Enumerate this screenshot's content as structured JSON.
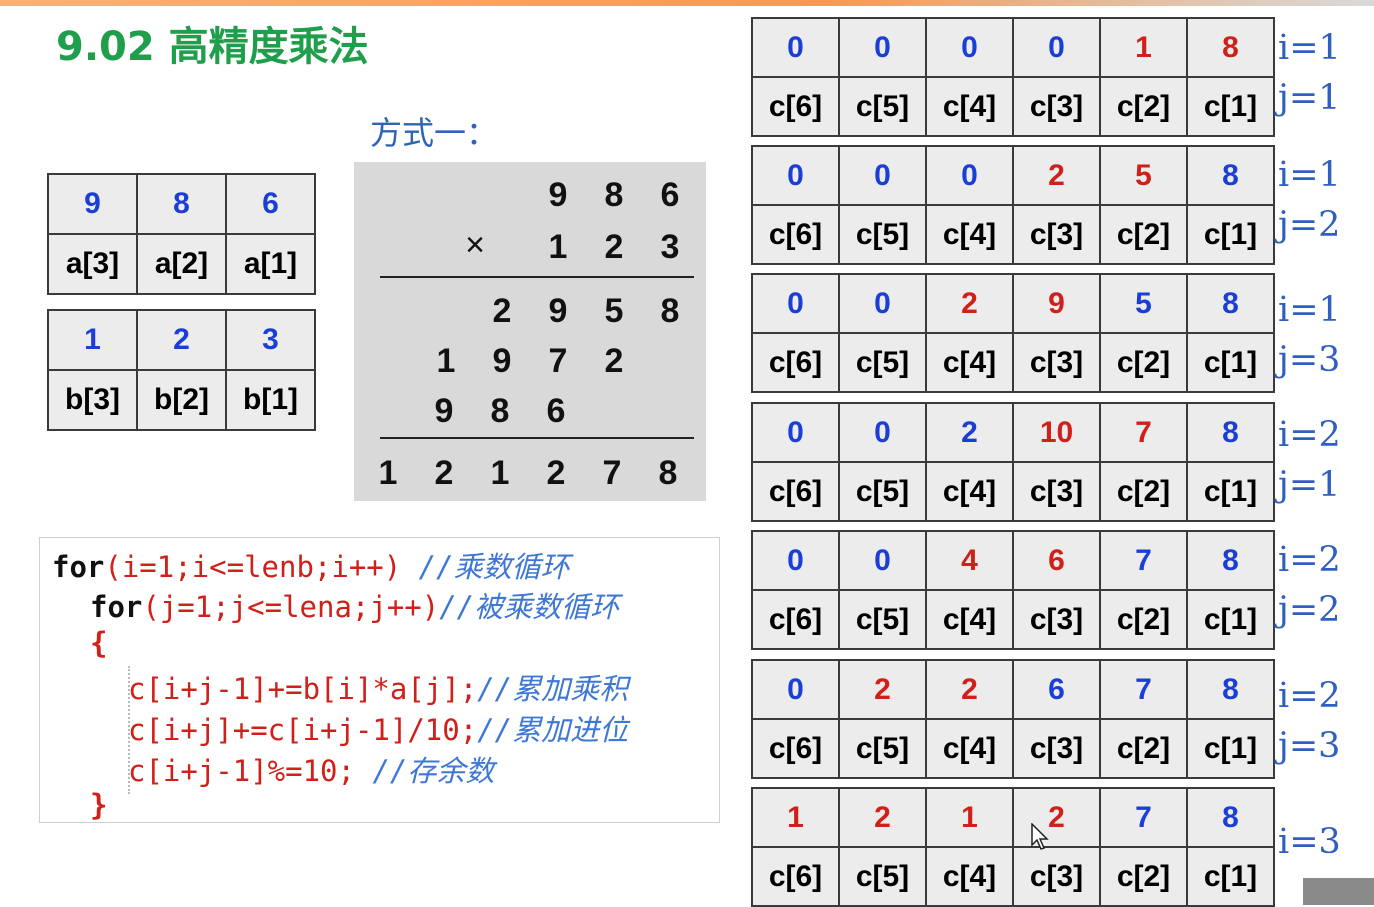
{
  "title": "9.02 高精度乘法",
  "method_label": "方式一：",
  "array_a": {
    "values": [
      "9",
      "8",
      "6"
    ],
    "labels": [
      "a[3]",
      "a[2]",
      "a[1]"
    ]
  },
  "array_b": {
    "values": [
      "1",
      "2",
      "3"
    ],
    "labels": [
      "b[3]",
      "b[2]",
      "b[1]"
    ]
  },
  "calculation": {
    "multiplicand": [
      "9",
      "8",
      "6"
    ],
    "times_sign": "×",
    "multiplier": [
      "1",
      "2",
      "3"
    ],
    "partial1": [
      "2",
      "9",
      "5",
      "8"
    ],
    "partial2": [
      "1",
      "9",
      "7",
      "2"
    ],
    "partial3": [
      "9",
      "8",
      "6"
    ],
    "result": [
      "1",
      "2",
      "1",
      "2",
      "7",
      "8"
    ]
  },
  "code": {
    "line1_a": "for",
    "line1_b": "(i=1;i<=lenb;i++)",
    "line1_c": " //乘数循环",
    "line2_a": "for",
    "line2_b": "(j=1;j<=lena;j++)",
    "line2_c": "//被乘数循环",
    "line3": "{",
    "line4_a": "c[i+j-1]+=b[i]*a[j];",
    "line4_c": "//累加乘积",
    "line5_a": "c[i+j]+=c[i+j-1]/10;",
    "line5_c": "//累加进位",
    "line6_a": "c[i+j-1]%=10;",
    "line6_c": " //存余数",
    "line7": "}"
  },
  "c_labels": [
    "c[6]",
    "c[5]",
    "c[4]",
    "c[3]",
    "c[2]",
    "c[1]"
  ],
  "steps": [
    {
      "i": "i=1",
      "j": "j=1",
      "values": [
        "0",
        "0",
        "0",
        "0",
        "1",
        "8"
      ],
      "colors": [
        "blue",
        "blue",
        "blue",
        "blue",
        "red",
        "red"
      ]
    },
    {
      "i": "i=1",
      "j": "j=2",
      "values": [
        "0",
        "0",
        "0",
        "2",
        "5",
        "8"
      ],
      "colors": [
        "blue",
        "blue",
        "blue",
        "red",
        "red",
        "blue"
      ]
    },
    {
      "i": "i=1",
      "j": "j=3",
      "values": [
        "0",
        "0",
        "2",
        "9",
        "5",
        "8"
      ],
      "colors": [
        "blue",
        "blue",
        "red",
        "red",
        "blue",
        "blue"
      ]
    },
    {
      "i": "i=2",
      "j": "j=1",
      "values": [
        "0",
        "0",
        "2",
        "10",
        "7",
        "8"
      ],
      "colors": [
        "blue",
        "blue",
        "blue",
        "red",
        "red",
        "blue"
      ]
    },
    {
      "i": "i=2",
      "j": "j=2",
      "values": [
        "0",
        "0",
        "4",
        "6",
        "7",
        "8"
      ],
      "colors": [
        "blue",
        "blue",
        "red",
        "red",
        "blue",
        "blue"
      ]
    },
    {
      "i": "i=2",
      "j": "j=3",
      "values": [
        "0",
        "2",
        "2",
        "6",
        "7",
        "8"
      ],
      "colors": [
        "blue",
        "red",
        "red",
        "blue",
        "blue",
        "blue"
      ]
    },
    {
      "i": "i=3",
      "j": "",
      "values": [
        "1",
        "2",
        "1",
        "2",
        "7",
        "8"
      ],
      "colors": [
        "red",
        "red",
        "red",
        "red",
        "blue",
        "blue"
      ]
    }
  ],
  "colors": {
    "blue": "#1b3fd6",
    "red": "#d0201a",
    "title_green": "#1f9e4b",
    "label_blue": "#2f5fc0"
  }
}
